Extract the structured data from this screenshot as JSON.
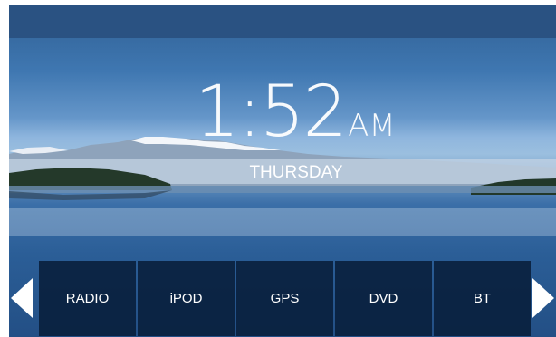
{
  "clock": {
    "time": "1:52",
    "ampm": "AM"
  },
  "day": "THURSDAY",
  "nav_items": [
    {
      "label": "RADIO"
    },
    {
      "label": "iPOD"
    },
    {
      "label": "GPS"
    },
    {
      "label": "DVD"
    },
    {
      "label": "BT"
    }
  ],
  "colors": {
    "top_bar": "#2a5282",
    "nav_tile": "#081e3a",
    "text": "#ffffff"
  },
  "icons": {
    "prev": "triangle-left-icon",
    "next": "triangle-right-icon"
  }
}
